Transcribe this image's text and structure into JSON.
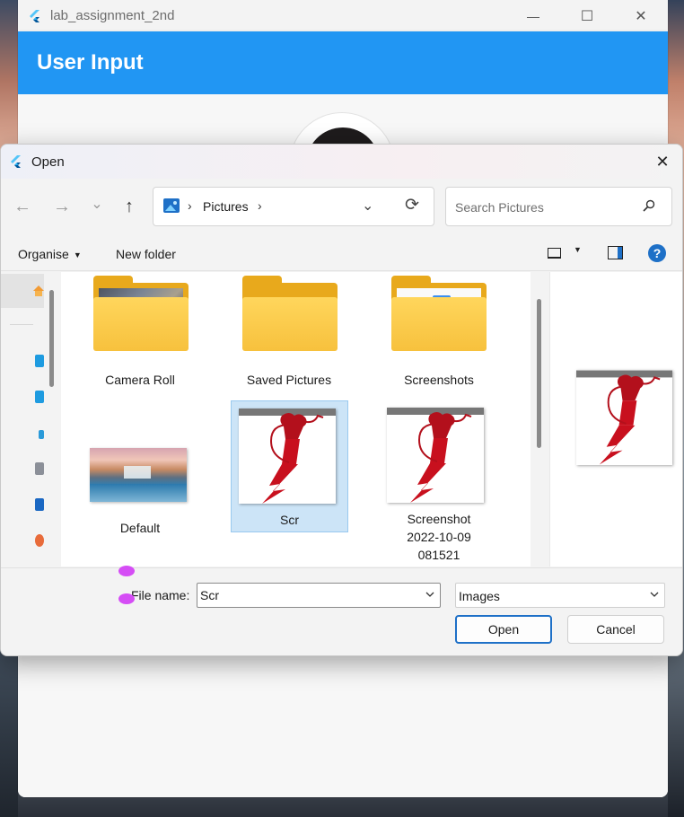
{
  "app_window": {
    "title": "lab_assignment_2nd",
    "controls": {
      "minimize": "—",
      "maximize": "☐",
      "close": "✕"
    },
    "appbar_title": "User Input"
  },
  "dialog": {
    "title": "Open",
    "close_glyph": "✕",
    "nav": {
      "back": "←",
      "forward": "→",
      "recent": "⌄",
      "up": "↑"
    },
    "address": {
      "location": "Pictures",
      "separator": "›",
      "dropdown": "⌄",
      "refresh": "⟳"
    },
    "search": {
      "placeholder": "Search Pictures"
    },
    "toolbar": {
      "organise": "Organise",
      "new_folder": "New folder",
      "help": "?"
    },
    "items": [
      {
        "label": "Camera Roll",
        "type": "folder"
      },
      {
        "label": "Saved Pictures",
        "type": "folder"
      },
      {
        "label": "Screenshots",
        "type": "folder"
      },
      {
        "label": "Default",
        "type": "image"
      },
      {
        "label": "Scr",
        "type": "image",
        "selected": true
      },
      {
        "label": "Screenshot 2022-10-09 081521",
        "line1": "Screenshot",
        "line2": "2022-10-09",
        "line3": "081521",
        "type": "image"
      }
    ],
    "file_name": {
      "label": "File name:",
      "value": "Scr"
    },
    "file_type": {
      "selected": "Images"
    },
    "buttons": {
      "open": "Open",
      "cancel": "Cancel"
    }
  },
  "colors": {
    "appbar": "#2196f3",
    "accent": "#1e70c7",
    "selection": "#cce4f7",
    "fist_red": "#c8101e"
  }
}
